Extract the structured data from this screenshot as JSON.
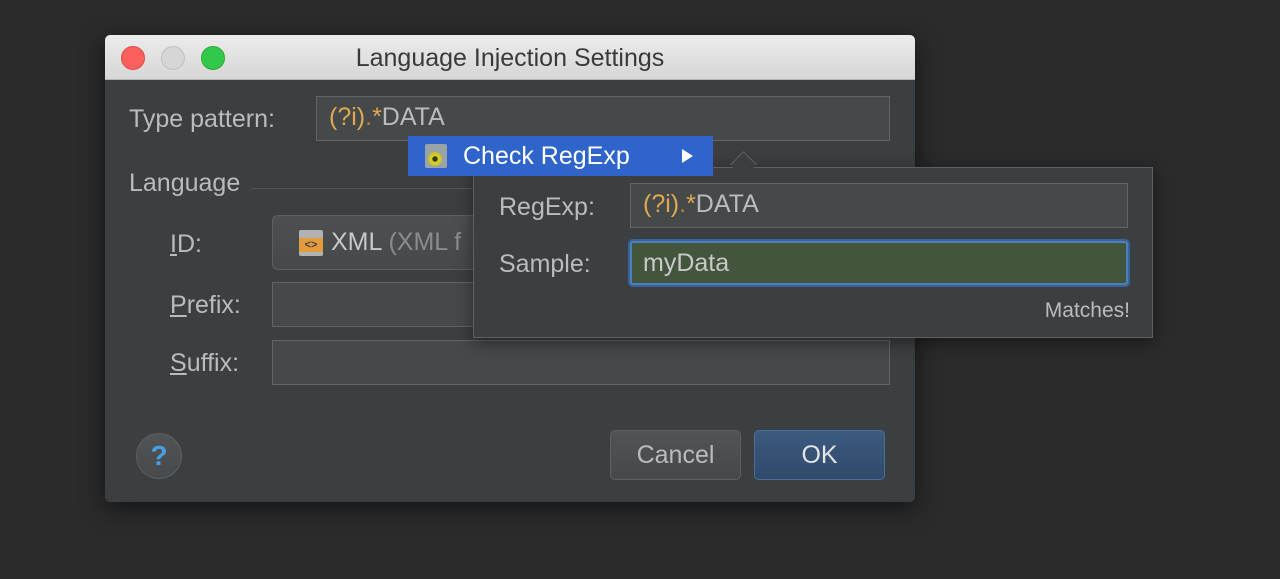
{
  "dialog": {
    "title": "Language Injection Settings",
    "type_pattern": {
      "label": "Type pattern:",
      "value_parts": [
        "(?i)",
        ".",
        "*",
        "DATA"
      ]
    },
    "language_section": "Language",
    "id": {
      "label_prefix": "",
      "label_mnemonic": "I",
      "label_rest": "D:",
      "value_main": "XML",
      "value_sub": "(XML f"
    },
    "prefix": {
      "label_mnemonic": "P",
      "label_rest": "refix:",
      "value": ""
    },
    "suffix": {
      "label_mnemonic": "S",
      "label_rest": "uffix:",
      "value": ""
    },
    "help_label": "?",
    "cancel_label": "Cancel",
    "ok_label": "OK"
  },
  "context_menu": {
    "item_label": "Check RegExp",
    "item_icon": "regexp-check-icon"
  },
  "regexp_popup": {
    "regexp_label": "RegExp:",
    "regexp_parts": [
      "(?i)",
      ".",
      "*",
      "DATA"
    ],
    "sample_label": "Sample:",
    "sample_value": "myData",
    "status": "Matches!"
  },
  "colors": {
    "selection": "#2f65ca",
    "ok_button": "#2f4a6b",
    "match_background": "#44553e",
    "regex_meta": "#e0a84f",
    "regex_dot": "#cc7832"
  }
}
